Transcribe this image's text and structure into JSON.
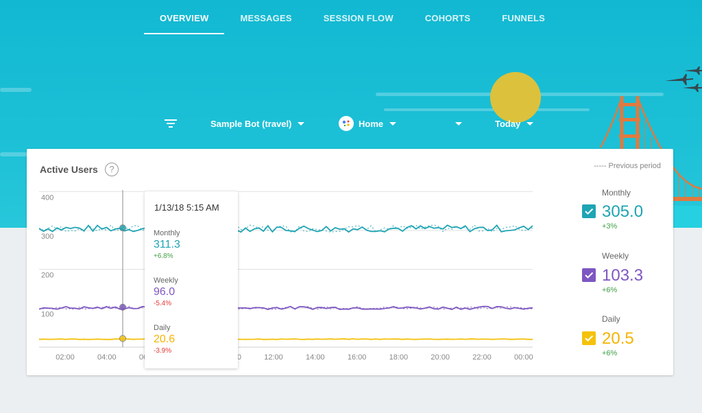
{
  "nav": {
    "tabs": [
      {
        "label": "OVERVIEW",
        "active": true
      },
      {
        "label": "MESSAGES",
        "active": false
      },
      {
        "label": "SESSION FLOW",
        "active": false
      },
      {
        "label": "COHORTS",
        "active": false
      },
      {
        "label": "FUNNELS",
        "active": false
      }
    ]
  },
  "filters": {
    "filter_icon": "filter-list-icon",
    "bot": "Sample Bot (travel)",
    "platform_icon": "google-assistant-icon",
    "platform": "Home",
    "extra": "",
    "range": "Today"
  },
  "card": {
    "title": "Active Users",
    "help_icon": "help-circle-icon",
    "previous_period": "----- Previous period"
  },
  "tooltip": {
    "date": "1/13/18 5:15 AM",
    "monthly": {
      "label": "Monthly",
      "value": "311.3",
      "change": "+6.8%"
    },
    "weekly": {
      "label": "Weekly",
      "value": "96.0",
      "change": "-5.4%"
    },
    "daily": {
      "label": "Daily",
      "value": "20.6",
      "change": "-3.9%"
    }
  },
  "legend": {
    "monthly": {
      "label": "Monthly",
      "value": "305.0",
      "change": "+3%",
      "color": "#1ea4b3"
    },
    "weekly": {
      "label": "Weekly",
      "value": "103.3",
      "change": "+6%",
      "color": "#7e57c2"
    },
    "daily": {
      "label": "Daily",
      "value": "20.5",
      "change": "+6%",
      "color": "#f4c20d"
    }
  },
  "chart_data": {
    "type": "line",
    "x_ticks": [
      "02:00",
      "04:00",
      "06:00",
      "08:00",
      "10:00",
      "12:00",
      "14:00",
      "16:00",
      "18:00",
      "20:00",
      "22:00",
      "00:00"
    ],
    "y_ticks": [
      400,
      300,
      200,
      100
    ],
    "ylim": [
      0,
      400
    ],
    "series": [
      {
        "name": "Monthly",
        "color": "#1ea4b3",
        "base": 305,
        "amp": 9
      },
      {
        "name": "Weekly",
        "color": "#7e57c2",
        "base": 101,
        "amp": 4
      },
      {
        "name": "Daily",
        "color": "#f4c20d",
        "base": 20.5,
        "amp": 0.8
      }
    ],
    "cursor_time": "1/13/18 5:15 AM"
  }
}
